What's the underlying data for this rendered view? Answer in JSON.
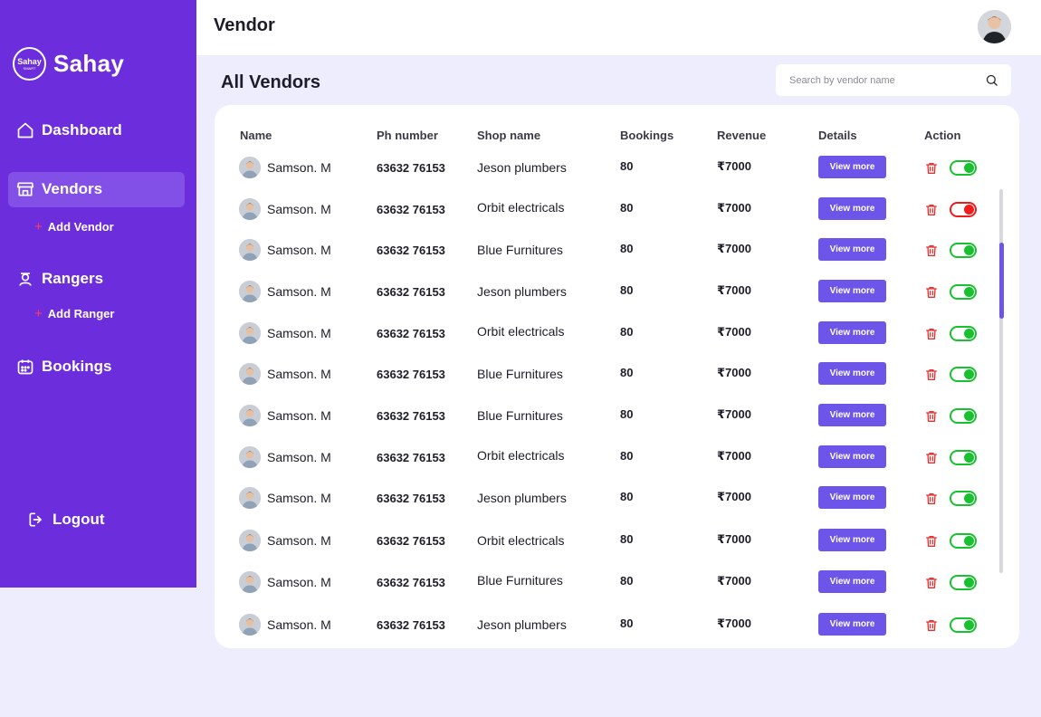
{
  "brand": {
    "logo_line1": "Sahay",
    "logo_line2": "SMART",
    "name": "Sahay"
  },
  "sidebar": {
    "dashboard": "Dashboard",
    "vendors": "Vendors",
    "add_vendor": "Add Vendor",
    "rangers": "Rangers",
    "add_ranger": "Add Ranger",
    "bookings": "Bookings",
    "logout": "Logout"
  },
  "header": {
    "title": "Vendor"
  },
  "main": {
    "section_title": "All Vendors"
  },
  "search": {
    "placeholder": "Search by vendor name"
  },
  "table": {
    "columns": [
      "Name",
      "Ph number",
      "Shop name",
      "Bookings",
      "Revenue",
      "Details",
      "Action"
    ],
    "view_label": "View more",
    "rows": [
      {
        "name": "Samson. M",
        "phone": "63632 76153",
        "shop": "Jeson plumbers",
        "bookings": "80",
        "revenue": "₹7000",
        "active": true
      },
      {
        "name": "Samson. M",
        "phone": "63632 76153",
        "shop": "Orbit electricals",
        "bookings": "80",
        "revenue": "₹7000",
        "active": false
      },
      {
        "name": "Samson. M",
        "phone": "63632 76153",
        "shop": "Blue Furnitures",
        "bookings": "80",
        "revenue": "₹7000",
        "active": true
      },
      {
        "name": "Samson. M",
        "phone": "63632 76153",
        "shop": "Jeson plumbers",
        "bookings": "80",
        "revenue": "₹7000",
        "active": true
      },
      {
        "name": "Samson. M",
        "phone": "63632 76153",
        "shop": "Orbit electricals",
        "bookings": "80",
        "revenue": "₹7000",
        "active": true
      },
      {
        "name": "Samson. M",
        "phone": "63632 76153",
        "shop": "Blue Furnitures",
        "bookings": "80",
        "revenue": "₹7000",
        "active": true
      },
      {
        "name": "Samson. M",
        "phone": "63632 76153",
        "shop": "Blue Furnitures",
        "bookings": "80",
        "revenue": "₹7000",
        "active": true
      },
      {
        "name": "Samson. M",
        "phone": "63632 76153",
        "shop": "Orbit electricals",
        "bookings": "80",
        "revenue": "₹7000",
        "active": true
      },
      {
        "name": "Samson. M",
        "phone": "63632 76153",
        "shop": "Jeson plumbers",
        "bookings": "80",
        "revenue": "₹7000",
        "active": true
      },
      {
        "name": "Samson. M",
        "phone": "63632 76153",
        "shop": "Orbit electricals",
        "bookings": "80",
        "revenue": "₹7000",
        "active": true
      },
      {
        "name": "Samson. M",
        "phone": "63632 76153",
        "shop": "Blue Furnitures",
        "bookings": "80",
        "revenue": "₹7000",
        "active": true
      },
      {
        "name": "Samson. M",
        "phone": "63632 76153",
        "shop": "Jeson plumbers",
        "bookings": "80",
        "revenue": "₹7000",
        "active": true
      }
    ]
  },
  "colors": {
    "sidebar": "#6c2ddc",
    "accent": "#6c55e8",
    "active_toggle": "#19c130",
    "inactive_toggle": "#ee1c1c",
    "delete": "#e53030"
  }
}
